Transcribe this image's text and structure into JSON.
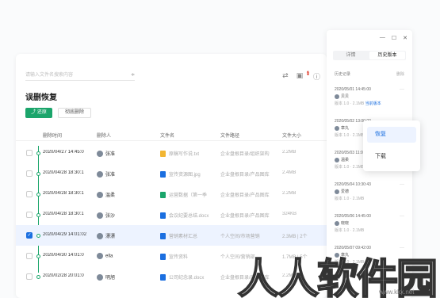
{
  "header": {
    "search_placeholder": "请输入文件名搜索内容",
    "chevron": "≑",
    "icons": [
      "switch-icon",
      "inbox-icon",
      "help-icon"
    ],
    "notif_count": "2"
  },
  "page_title": "误删恢复",
  "actions": {
    "restore": "还原",
    "permanent_delete": "彻底删除"
  },
  "table": {
    "columns": [
      "删除时间",
      "删除人",
      "文件名",
      "文件路径",
      "文件大小"
    ],
    "rows": [
      {
        "time": "2020/04/27 14:45:0",
        "user": "张准",
        "file": "原稿写作说.txt",
        "path": "企业盘根目录/组织架构",
        "size": "2.2MB",
        "color": "#f2b633"
      },
      {
        "time": "2020/04/28 18:30:1",
        "user": "张准",
        "file": "宣传资源图.jpg",
        "path": "企业盘根目录/产品图库",
        "size": "2.4MB",
        "color": "#1b6fe0"
      },
      {
        "time": "2020/04/28 18:30:1",
        "user": "温柔",
        "file": "运营数据（第一季",
        "path": "企业盘根目录/产品图库",
        "size": "2.2MB",
        "color": "#1ba56b"
      },
      {
        "time": "2020/04/28 18:30:1",
        "user": "张沙",
        "file": "会议纪要总结.docx",
        "path": "企业盘根目录/产品图库",
        "size": "324KB",
        "color": "#1b6fe0"
      },
      {
        "time": "2020/04/29 14:01:02",
        "user": "漂漂",
        "file": "营销素材汇总",
        "path": "个人空间/市场营销",
        "size": "2.3MB | 2个",
        "color": "#1b6fe0"
      },
      {
        "time": "2020/04/30 14:01:0",
        "user": "ella",
        "file": "宣传资料",
        "path": "个人空间/营销部",
        "size": "1.7MB | 5个",
        "color": "#1b6fe0"
      },
      {
        "time": "2020/02/28 20:01:0",
        "user": "明旭",
        "file": "公司纪念录.docx",
        "path": "企业盘根目录/产品图库",
        "size": "2.2MB",
        "color": "#1b6fe0"
      }
    ],
    "selected_index": 4
  },
  "history": {
    "tabs": [
      "详情",
      "历史版本"
    ],
    "active_tab": 1,
    "header_left": "历史记录",
    "header_right": "删除",
    "items": [
      {
        "time": "2020/05/01 14:45:00",
        "user": "贝贝",
        "note": "版本 1.0 · 2.1MB",
        "link": "当前版本"
      },
      {
        "time": "2020/05/02 13:00:00",
        "user": "章丸",
        "note": "版本 1.0 · 2.1MB",
        "link": ""
      },
      {
        "time": "2020/05/03 11:00:00",
        "user": "温柔",
        "note": "版本 1.0 · 2.1MB",
        "link": ""
      },
      {
        "time": "2020/05/04 10:30:43",
        "user": "爱德",
        "note": "版本 1.0 · 2.1MB",
        "link": ""
      },
      {
        "time": "2020/05/06 14:45:00",
        "user": "晓晓",
        "note": "版本 1.0 · 2.1MB",
        "link": ""
      },
      {
        "time": "2020/05/07 09:42:00",
        "user": "章丸",
        "note": "版本 1.0 · 2.1MB",
        "link": ""
      }
    ]
  },
  "menu": {
    "restore": "恢复",
    "download": "下载"
  },
  "watermark": {
    "text": "人人软件园",
    "url": "www.kkx.net"
  }
}
